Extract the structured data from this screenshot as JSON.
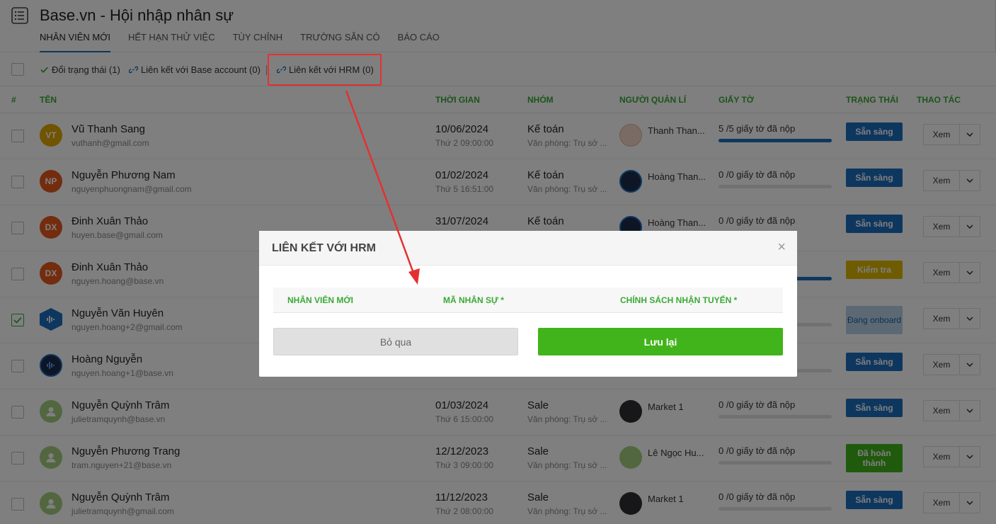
{
  "header": {
    "title": "Base.vn - Hội nhập nhân sự",
    "tabs": [
      "NHÂN VIÊN MỚI",
      "HẾT HẠN THỬ VIỆC",
      "TÙY CHỈNH",
      "TRƯỜNG SẴN CÓ",
      "BÁO CÁO"
    ]
  },
  "toolbar": {
    "change_status": "Đổi trạng thái (1)",
    "link_base": "Liên kết với Base account (0)",
    "link_hrm": "Liên kết với HRM (0)"
  },
  "table": {
    "headers": [
      "#",
      "TÊN",
      "THỜI GIAN",
      "NHÓM",
      "NGƯỜI QUẢN LÍ",
      "GIẤY TỜ",
      "TRẠNG THÁI",
      "THAO TÁC"
    ],
    "view_label": "Xem",
    "rows": [
      {
        "initials": "VT",
        "name": "Vũ Thanh Sang",
        "email": "vuthanh@gmail.com",
        "date": "10/06/2024",
        "time": "Thứ 2 09:00:00",
        "group": "Kế toán",
        "office": "Văn phòng: Trụ sở ...",
        "manager": "Thanh Than...",
        "docs": "5 /5 giấy tờ đã nộp",
        "progress": 1.0,
        "status": "Sẵn sàng"
      },
      {
        "initials": "NP",
        "name": "Nguyễn Phương Nam",
        "email": "nguyenphuongnam@gmail.com",
        "date": "01/02/2024",
        "time": "Thứ 5 16:51:00",
        "group": "Kế toán",
        "office": "Văn phòng: Trụ sở ...",
        "manager": "Hoàng Than...",
        "docs": "0 /0 giấy tờ đã nộp",
        "progress": 0,
        "status": "Sẵn sàng"
      },
      {
        "initials": "DX",
        "name": "Đinh Xuân Thảo",
        "email": "huyen.base@gmail.com",
        "date": "31/07/2024",
        "time": "",
        "group": "Kế toán",
        "office": "",
        "manager": "Hoàng Than...",
        "docs": "0 /0 giấy tờ đã nộp",
        "progress": 0,
        "status": "Sẵn sàng"
      },
      {
        "initials": "DX",
        "name": "Đinh Xuân Thảo",
        "email": "nguyen.hoang@base.vn",
        "date": "",
        "time": "",
        "group": "",
        "office": "",
        "manager": "",
        "docs": "",
        "progress": 1.0,
        "status": "Kiểm tra"
      },
      {
        "initials": "",
        "name": "Nguyễn Văn Huyên",
        "email": "nguyen.hoang+2@gmail.com",
        "date": "",
        "time": "",
        "group": "",
        "office": "",
        "manager": "",
        "docs": "",
        "progress": 0,
        "status": "Đang onboard"
      },
      {
        "initials": "",
        "name": "Hoàng Nguyễn",
        "email": "nguyen.hoang+1@base.vn",
        "date": "",
        "time": "",
        "group": "",
        "office": "",
        "manager": "",
        "docs": "",
        "progress": 0,
        "status": "Sẵn sàng"
      },
      {
        "initials": "",
        "name": "Nguyễn Quỳnh Trâm",
        "email": "julietramquynh@base.vn",
        "date": "01/03/2024",
        "time": "Thứ 6 15:00:00",
        "group": "Sale",
        "office": "Văn phòng: Trụ sở ...",
        "manager": "Market 1",
        "docs": "0 /0 giấy tờ đã nộp",
        "progress": 0,
        "status": "Sẵn sàng"
      },
      {
        "initials": "",
        "name": "Nguyễn Phương Trang",
        "email": "tram.nguyen+21@base.vn",
        "date": "12/12/2023",
        "time": "Thứ 3 09:00:00",
        "group": "Sale",
        "office": "Văn phòng: Trụ sở ...",
        "manager": "Lê Ngọc Hu...",
        "docs": "0 /0 giấy tờ đã nộp",
        "progress": 0,
        "status": "Đã hoàn thành"
      },
      {
        "initials": "",
        "name": "Nguyễn Quỳnh Trâm",
        "email": "julietramquynh@gmail.com",
        "date": "11/12/2023",
        "time": "Thứ 2 08:00:00",
        "group": "Sale",
        "office": "Văn phòng: Trụ sở ...",
        "manager": "Market 1",
        "docs": "0 /0 giấy tờ đã nộp",
        "progress": 0,
        "status": "Sẵn sàng"
      }
    ]
  },
  "modal": {
    "title": "LIÊN KẾT VỚI HRM",
    "close": "×",
    "columns": [
      "NHÂN VIÊN MỚI",
      "MÃ NHÂN SỰ *",
      "CHÍNH SÁCH NHẬN TUYỂN *"
    ],
    "skip": "Bỏ qua",
    "save": "Lưu lại"
  },
  "colors": {
    "accent_green": "#41b41b",
    "primary_blue": "#1d6fbf",
    "warning_yellow": "#e0b800",
    "highlight_red": "#e53030"
  }
}
